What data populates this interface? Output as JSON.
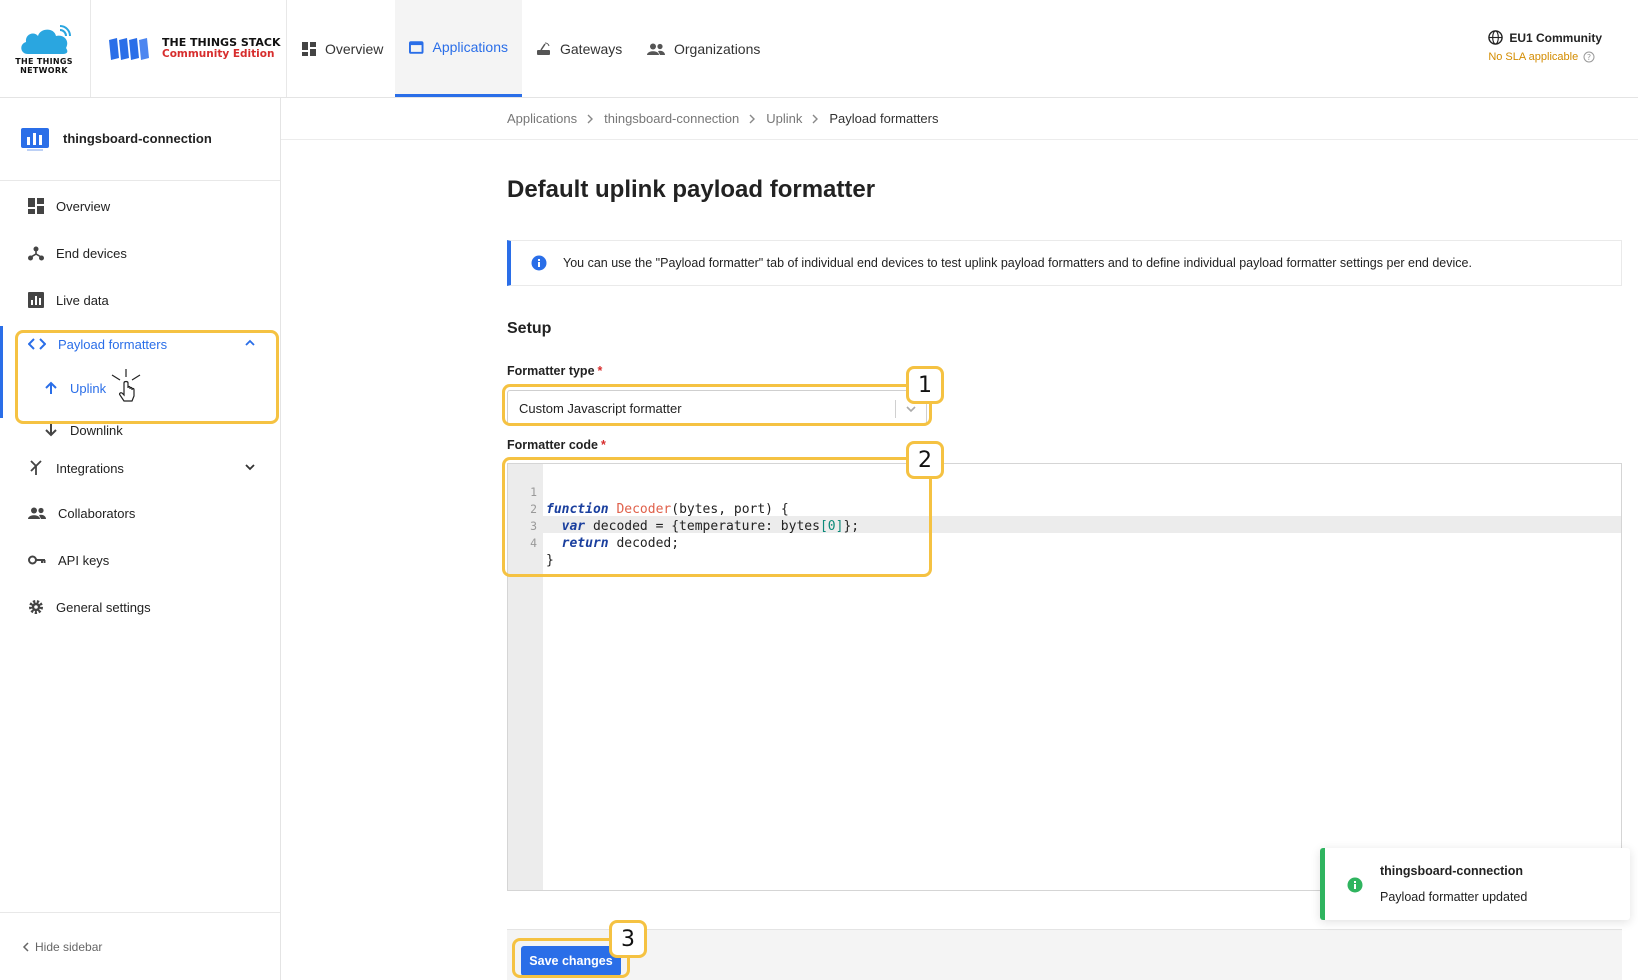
{
  "header": {
    "ttn_logo_text": "THE THINGS NETWORK",
    "tts_title": "THE THINGS STACK",
    "tts_edition": "Community Edition",
    "nav": [
      {
        "label": "Overview",
        "icon": "dashboard-icon"
      },
      {
        "label": "Applications",
        "icon": "application-icon",
        "active": true
      },
      {
        "label": "Gateways",
        "icon": "gateway-icon"
      },
      {
        "label": "Organizations",
        "icon": "people-icon"
      }
    ],
    "region": "EU1 Community",
    "sla": "No SLA applicable"
  },
  "sidebar": {
    "app_name": "thingsboard-connection",
    "items": [
      {
        "label": "Overview",
        "icon": "dashboard-icon"
      },
      {
        "label": "End devices",
        "icon": "devices-icon"
      },
      {
        "label": "Live data",
        "icon": "bar-chart-icon"
      },
      {
        "label": "Payload formatters",
        "icon": "code-icon",
        "active": true,
        "expanded": true
      },
      {
        "label": "Uplink",
        "icon": "arrow-up-icon",
        "active": true
      },
      {
        "label": "Downlink",
        "icon": "arrow-down-icon"
      },
      {
        "label": "Integrations",
        "icon": "integrations-icon"
      },
      {
        "label": "Collaborators",
        "icon": "people-icon"
      },
      {
        "label": "API keys",
        "icon": "key-icon"
      },
      {
        "label": "General settings",
        "icon": "gear-icon"
      }
    ],
    "hide_label": "Hide sidebar"
  },
  "breadcrumb": [
    "Applications",
    "thingsboard-connection",
    "Uplink",
    "Payload formatters"
  ],
  "main": {
    "title": "Default uplink payload formatter",
    "info": "You can use the \"Payload formatter\" tab of individual end devices to test uplink payload formatters and to define individual payload formatter settings per end device.",
    "section": "Setup",
    "formatter_type_label": "Formatter type",
    "formatter_type_value": "Custom Javascript formatter",
    "formatter_code_label": "Formatter code",
    "required_mark": "*",
    "code_lines": [
      "function Decoder(bytes, port) {",
      "  var decoded = {temperature: bytes[0]};",
      "  return decoded;",
      "}"
    ],
    "line_numbers": [
      "1",
      "2",
      "3",
      "4"
    ],
    "save_label": "Save changes"
  },
  "annotations": [
    "1",
    "2",
    "3"
  ],
  "toast": {
    "title": "thingsboard-connection",
    "message": "Payload formatter updated"
  },
  "colors": {
    "accent": "#2a6ee8",
    "highlight": "#f5c242",
    "success": "#2fb45f",
    "required": "#d72d2d",
    "sla": "#d38c00"
  }
}
